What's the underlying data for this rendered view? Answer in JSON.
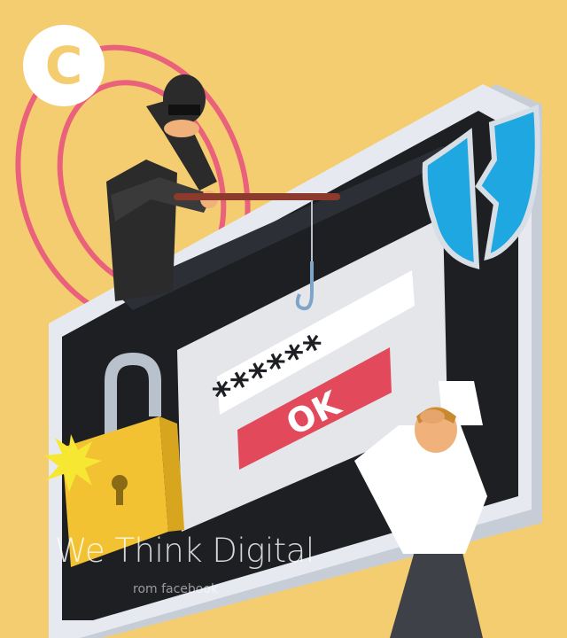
{
  "badge": {
    "letter": "C"
  },
  "screen": {
    "password_mask": "******",
    "ok_label": "OK"
  },
  "watermark": {
    "title": "We Think Digital",
    "subtitle": "rom facebook"
  },
  "colors": {
    "background": "#F4CD71",
    "monitor_frame": "#E6EAF0",
    "monitor_screen": "#1D1F22",
    "ok_button": "#E24A5B",
    "rings": "#E9617A",
    "shield": "#1EA7E1",
    "lock": "#F2C233"
  }
}
